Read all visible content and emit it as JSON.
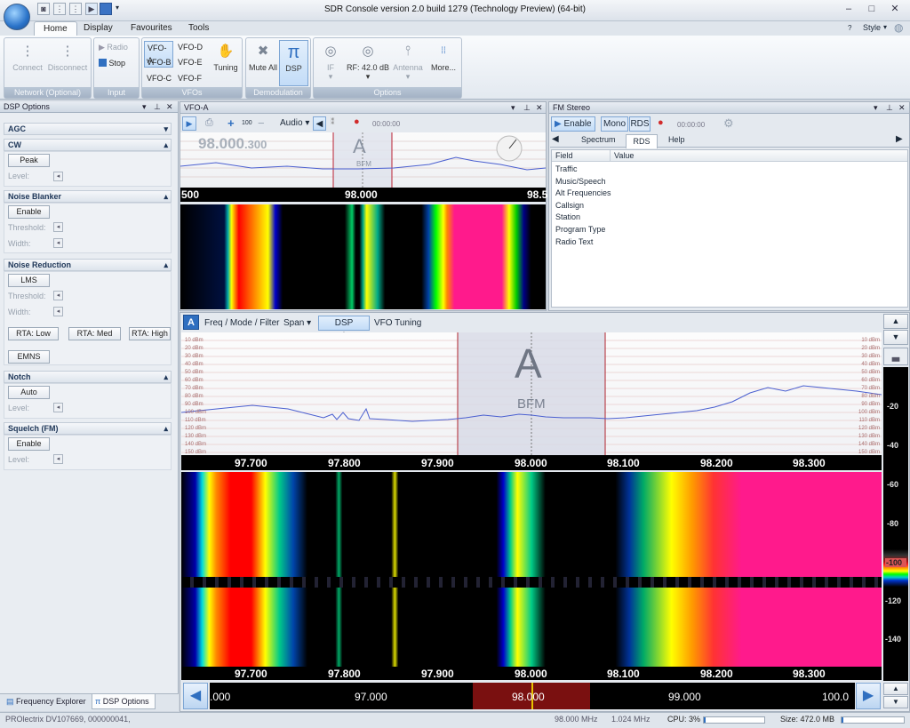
{
  "window": {
    "title": "SDR Console version 2.0 build 1279 (Technology Preview) (64-bit)",
    "style_label": "Style"
  },
  "ribbon_tabs": [
    "Home",
    "Display",
    "Favourites",
    "Tools"
  ],
  "ribbon": {
    "network": {
      "connect": "Connect",
      "disconnect": "Disconnect",
      "label": "Network (Optional)"
    },
    "input": {
      "radio": "Radio",
      "stop": "Stop",
      "label": "Input"
    },
    "vfos": {
      "items": [
        "VFO-A",
        "VFO-D",
        "VFO-B",
        "VFO-E",
        "VFO-C",
        "VFO-F"
      ],
      "tuning": "Tuning",
      "label": "VFOs"
    },
    "demod": {
      "mute": "Mute All",
      "dsp": "DSP",
      "label": "Demodulation"
    },
    "options": {
      "if": "IF",
      "rf": "RF: 42.0 dB",
      "antenna": "Antenna",
      "more": "More...",
      "label": "Options"
    }
  },
  "dsp_panel": {
    "title": "DSP Options",
    "agc": "AGC",
    "cw": "CW",
    "peak": "Peak",
    "level": "Level:",
    "nb": "Noise Blanker",
    "enable": "Enable",
    "threshold": "Threshold:",
    "width": "Width:",
    "nr": "Noise Reduction",
    "lms": "LMS",
    "rta_low": "RTA: Low",
    "rta_med": "RTA: Med",
    "rta_high": "RTA: High",
    "emns": "EMNS",
    "notch": "Notch",
    "auto": "Auto",
    "squelch": "Squelch (FM)"
  },
  "vfo_panel": {
    "title": "VFO-A",
    "gain": "100",
    "audio": "Audio",
    "time": "00:00:00",
    "freq_main": "98.000",
    "freq_sub": ".300",
    "vfo_letter": "A",
    "mode": "BFM",
    "axis": [
      "500",
      "98.000",
      "98.5"
    ]
  },
  "fm_panel": {
    "title": "FM Stereo",
    "enable": "Enable",
    "mono": "Mono",
    "rds": "RDS",
    "time": "00:00:00",
    "tabs": [
      "Spectrum",
      "RDS",
      "Help"
    ],
    "columns": [
      "Field",
      "Value"
    ],
    "rows": [
      "Traffic",
      "Music/Speech",
      "Alt Frequencies",
      "Callsign",
      "Station",
      "Program Type",
      "Radio Text"
    ]
  },
  "main_toolbar": {
    "letter": "A",
    "items": [
      "Freq / Mode / Filter",
      "Span",
      "DSP Options",
      "VFO Tuning"
    ]
  },
  "spectrum": {
    "vfo_letter": "A",
    "mode": "BFM",
    "dbm_labels": [
      "10 dBm",
      "20 dBm",
      "30 dBm",
      "40 dBm",
      "50 dBm",
      "60 dBm",
      "70 dBm",
      "80 dBm",
      "90 dBm",
      "100 dBm",
      "110 dBm",
      "120 dBm",
      "130 dBm",
      "140 dBm",
      "150 dBm"
    ],
    "axis": [
      "97.700",
      "97.800",
      "97.900",
      "98.000",
      "98.100",
      "98.200",
      "98.300"
    ],
    "colour_scale": [
      "-20",
      "-40",
      "-60",
      "-80",
      "-100",
      "-120",
      "-140"
    ]
  },
  "overview": {
    "labels": [
      ".000",
      "97.000",
      "98.000",
      "99.000",
      "100.0"
    ]
  },
  "bottom_tabs": [
    "Frequency Explorer",
    "DSP Options"
  ],
  "status": {
    "device": "PROlectrix DV107669, 000000041,",
    "freq": "98.000 MHz",
    "bw": "1.024 MHz",
    "cpu": "CPU: 3%",
    "size": "Size: 472.0 MB"
  },
  "colors": {
    "accent": "#2f6fc0",
    "waterfall_hot": "#ff1a8c"
  }
}
